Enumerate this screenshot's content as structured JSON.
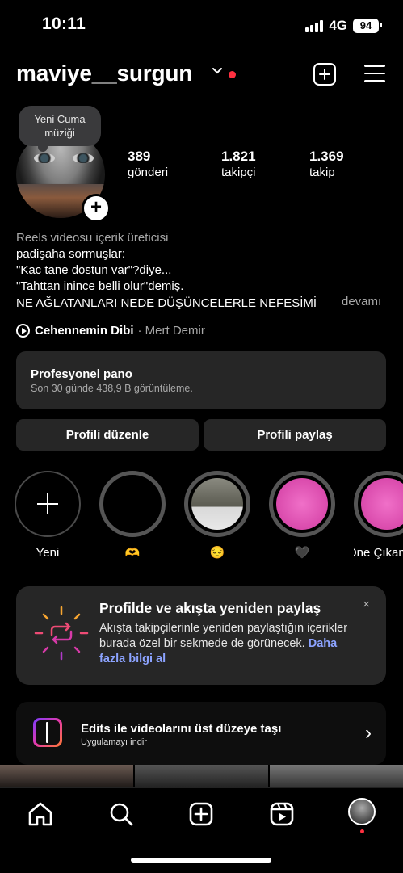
{
  "status_bar": {
    "time": "10:11",
    "network": "4G",
    "battery": "94"
  },
  "header": {
    "username": "maviye__surgun"
  },
  "profile": {
    "note": "Yeni Cuma müziği",
    "stats": [
      {
        "value": "389",
        "label": "gönderi"
      },
      {
        "value": "1.821",
        "label": "takipçi"
      },
      {
        "value": "1.369",
        "label": "takip"
      }
    ],
    "category": "Reels videosu içerik üreticisi",
    "bio_lines": [
      "padişaha sormuşlar:",
      "\"Kac tane dostun var\"?diye...",
      "\"Tahttan inince belli olur\"demiş.",
      "NE AĞLATANLARI NEDE DÜŞÜNCELERLE NEFESİMİ"
    ],
    "more_label": "devamı",
    "music": {
      "title": "Cehennemin Dibi",
      "artist": "· Mert Demir"
    }
  },
  "dashboard": {
    "title": "Profesyonel pano",
    "subtitle": "Son 30 günde 438,9 B görüntüleme."
  },
  "actions": {
    "edit": "Profili düzenle",
    "share": "Profili paylaş"
  },
  "highlights": [
    {
      "label": "Yeni"
    },
    {
      "label": "🫶"
    },
    {
      "label": "😔"
    },
    {
      "label": "🖤"
    },
    {
      "label": "Öne Çıkan"
    }
  ],
  "repost_card": {
    "title": "Profilde ve akışta yeniden paylaş",
    "body": "Akışta takipçilerinle yeniden paylaştığın içerikler burada özel bir sekmede de görünecek.",
    "link": "Daha fazla bilgi al",
    "close": "×"
  },
  "edits_banner": {
    "title": "Edits ile videolarını üst düzeye taşı",
    "subtitle": "Uygulamayı indir",
    "arrow": "›"
  },
  "nav": [
    "home-icon",
    "search-icon",
    "create-icon",
    "reels-icon",
    "profile-avatar"
  ],
  "colors": {
    "background": "#000000",
    "card": "#262626",
    "accent_link": "#8ca3ff",
    "notification": "#ff3040"
  }
}
